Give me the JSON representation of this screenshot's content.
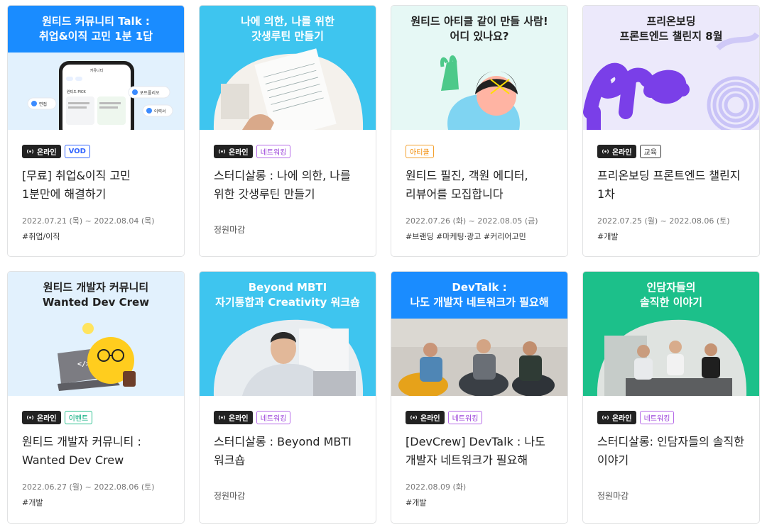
{
  "online_label": "온라인",
  "cards": [
    {
      "banner_lines": [
        "원티드 커뮤니티 Talk :",
        "취업&이직 고민 1분 1답"
      ],
      "banner_phone": {
        "header": "커뮤니티",
        "section": "원티드 PICK",
        "chip_left": "면접",
        "chip_right1": "포트폴리오",
        "chip_right2": "이력서"
      },
      "tag": "VOD",
      "title": "[무료] 취업&이직 고민 1분만에 해결하기",
      "date": "2022.07.21 (목) ~ 2022.08.04 (목)",
      "hashtags": "#취업/이직"
    },
    {
      "banner_lines": [
        "나에 의한, 나를 위한",
        "갓생루틴 만들기"
      ],
      "tag": "네트워킹",
      "title": "스터디살롱 : 나에 의한, 나를 위한 갓생루틴 만들기",
      "status": "정원마감"
    },
    {
      "banner_lines": [
        "원티드 아티클 같이 만들 사람!",
        "어디 있나요?"
      ],
      "online": false,
      "tag": "아티클",
      "title": "원티드 필진, 객원 에디터, 리뷰어를 모집합니다",
      "date": "2022.07.26 (화) ~ 2022.08.05 (금)",
      "hashtags": "#브랜딩 #마케팅·광고 #커리어고민"
    },
    {
      "banner_lines": [
        "프리온보딩",
        "프론트엔드 챌린지 8월"
      ],
      "tag": "교육",
      "title": "프리온보딩 프론트엔드 챌린지 1차",
      "date": "2022.07.25 (월) ~ 2022.08.06 (토)",
      "hashtags": "#개발"
    },
    {
      "banner_lines": [
        "원티드 개발자 커뮤니티",
        "Wanted Dev Crew"
      ],
      "tag": "이벤트",
      "title": "원티드 개발자 커뮤니티 : Wanted Dev Crew",
      "date": "2022.06.27 (월) ~ 2022.08.06 (토)",
      "hashtags": "#개발"
    },
    {
      "banner_lines": [
        "Beyond MBTI",
        "자기통합과 Creativity 워크숍"
      ],
      "tag": "네트워킹",
      "title": "스터디살롱 : Beyond MBTI 워크숍",
      "status": "정원마감"
    },
    {
      "banner_lines": [
        "DevTalk :",
        "나도 개발자 네트워크가 필요해"
      ],
      "tag": "네트워킹",
      "title": "[DevCrew] DevTalk : 나도 개발자 네트워크가 필요해",
      "date": "2022.08.09 (화)",
      "hashtags": "#개발"
    },
    {
      "banner_lines": [
        "인담자들의",
        "솔직한 이야기"
      ],
      "tag": "네트워킹",
      "title": "스터디살롱: 인담자들의 솔직한 이야기",
      "status": "정원마감"
    }
  ],
  "colors": {
    "dev_talk_blue": "#1a8cff",
    "cyan": "#3ec5ef",
    "mint": "#e6f8f5",
    "lavender": "#ece9fb",
    "light_blue": "#e2f1fd",
    "green": "#1cc08a"
  },
  "icons": [
    "broadcast-icon",
    "check-icon"
  ]
}
